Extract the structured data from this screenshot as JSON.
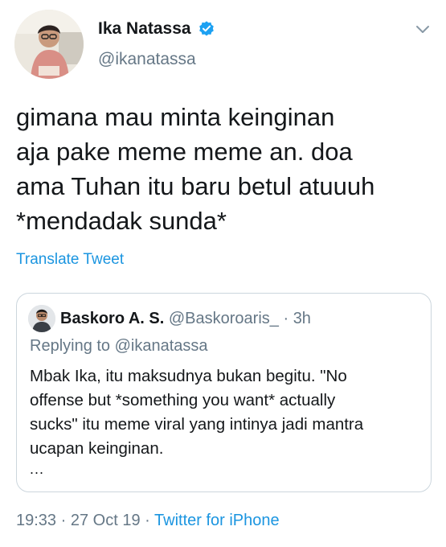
{
  "author": {
    "name": "Ika Natassa",
    "handle": "@ikanatassa",
    "verified_icon": "verified-badge-icon",
    "accent": "#1da1f2"
  },
  "tweet": {
    "lines": [
      "gimana mau minta keinginan",
      "aja pake meme meme an. doa",
      "ama Tuhan itu baru betul atuuuh",
      "*mendadak sunda*"
    ],
    "translate_label": "Translate Tweet"
  },
  "quoted": {
    "name": "Baskoro A. S.",
    "handle": "@Baskoroaris_",
    "separator": "·",
    "time": "3h",
    "replying_to": "Replying to @ikanatassa",
    "lines": [
      "Mbak Ika, itu maksudnya bukan begitu. \"No",
      "offense but *something you want* actually",
      "sucks\" itu meme viral yang intinya jadi mantra",
      "ucapan keinginan."
    ],
    "more": "..."
  },
  "meta": {
    "time": "19:33",
    "sep1": "·",
    "date": "27 Oct 19",
    "sep2": "·",
    "source": "Twitter for iPhone"
  },
  "colors": {
    "text": "#14171a",
    "secondary": "#657786",
    "link": "#1b95e0",
    "border": "#ccd6dd"
  }
}
